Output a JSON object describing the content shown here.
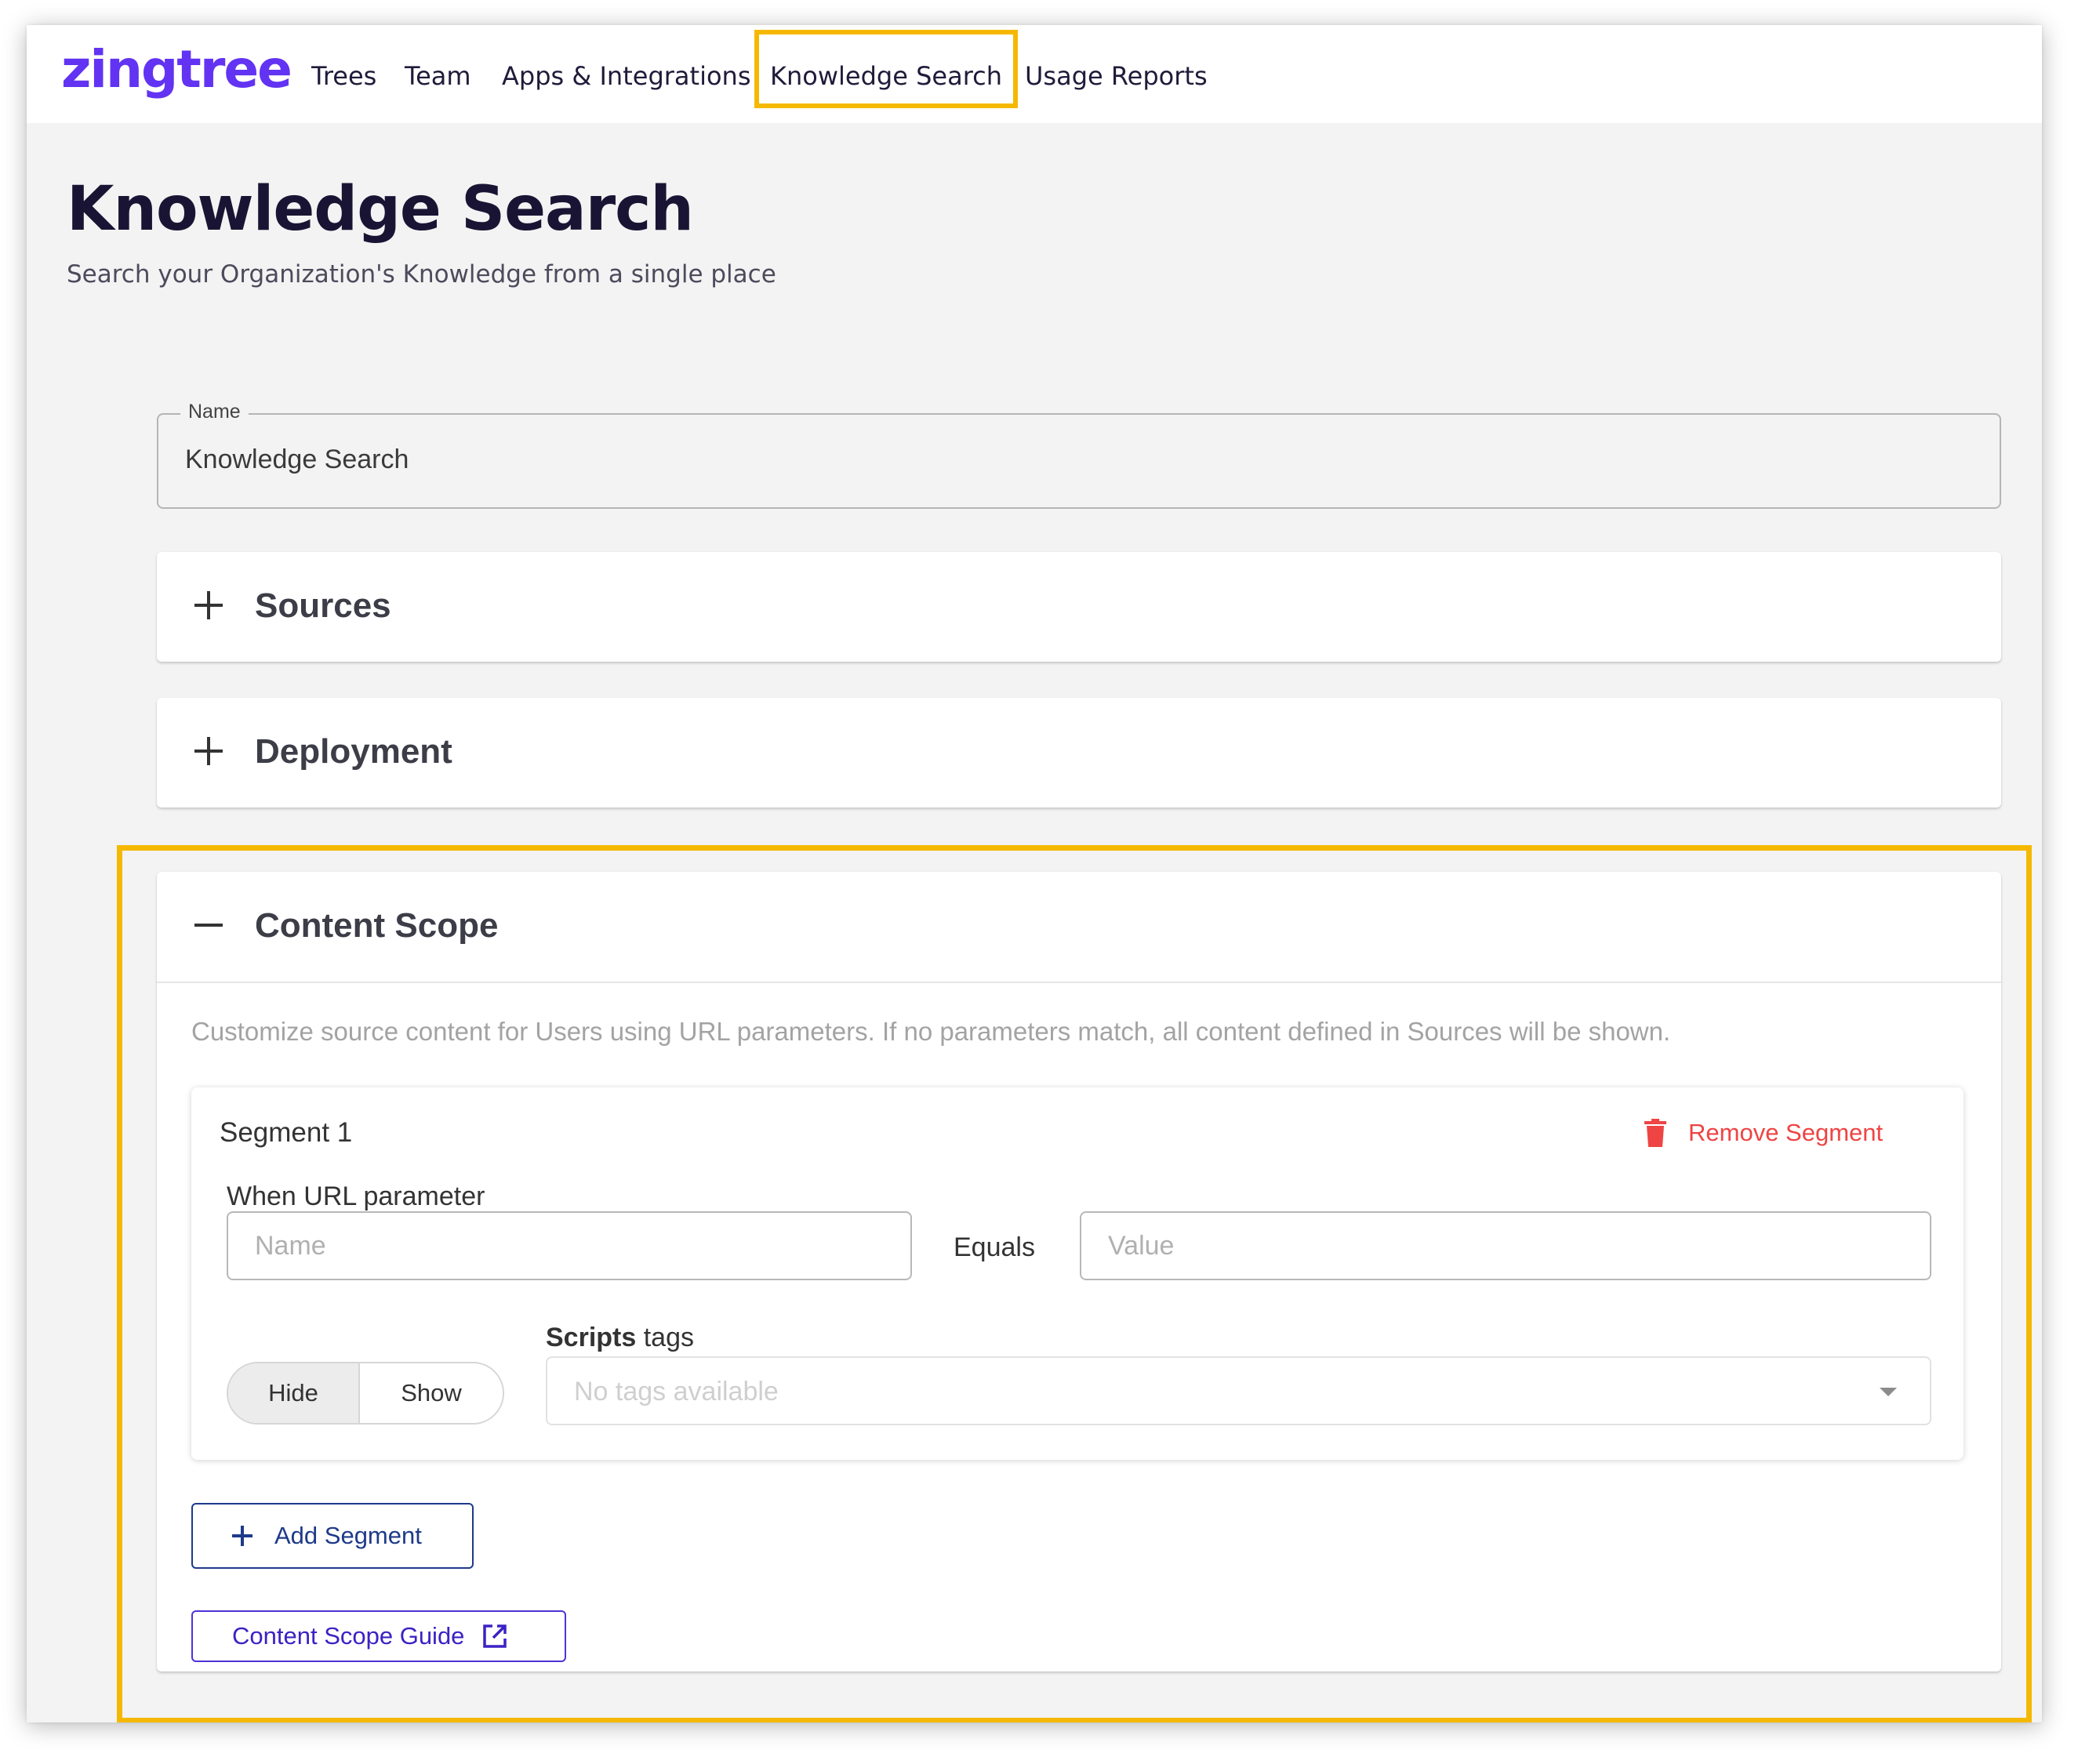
{
  "brand": {
    "logo": "zingtree",
    "logo_color": "#6233f2"
  },
  "nav": {
    "items": [
      {
        "label": "Trees"
      },
      {
        "label": "Team"
      },
      {
        "label": "Apps & Integrations"
      },
      {
        "label": "Knowledge Search",
        "active": true
      },
      {
        "label": "Usage Reports"
      }
    ]
  },
  "page": {
    "title": "Knowledge Search",
    "subtitle": "Search your Organization's Knowledge from a single place"
  },
  "name_field": {
    "label": "Name",
    "value": "Knowledge Search"
  },
  "panels": {
    "sources": {
      "title": "Sources",
      "icon": "plus-icon",
      "expanded": false
    },
    "deployment": {
      "title": "Deployment",
      "icon": "plus-icon",
      "expanded": false
    },
    "content_scope": {
      "title": "Content Scope",
      "icon": "minus-icon",
      "expanded": true,
      "description": "Customize source content for Users using URL parameters. If no parameters match, all content defined in Sources will be shown."
    }
  },
  "segment": {
    "title": "Segment 1",
    "remove_label": "Remove Segment",
    "when_label": "When URL parameter",
    "name_placeholder": "Name",
    "equals_label": "Equals",
    "value_placeholder": "Value",
    "toggle": {
      "hide": "Hide",
      "show": "Show",
      "selected": "Hide"
    },
    "tags_label_bold": "Scripts",
    "tags_label_rest": " tags",
    "tags_placeholder": "No tags available"
  },
  "buttons": {
    "add_segment": "Add Segment",
    "guide": "Content Scope Guide"
  },
  "colors": {
    "highlight": "#f5b800",
    "danger": "#ef4444",
    "primary": "#1e3a8a",
    "accent": "#4f32d8"
  }
}
